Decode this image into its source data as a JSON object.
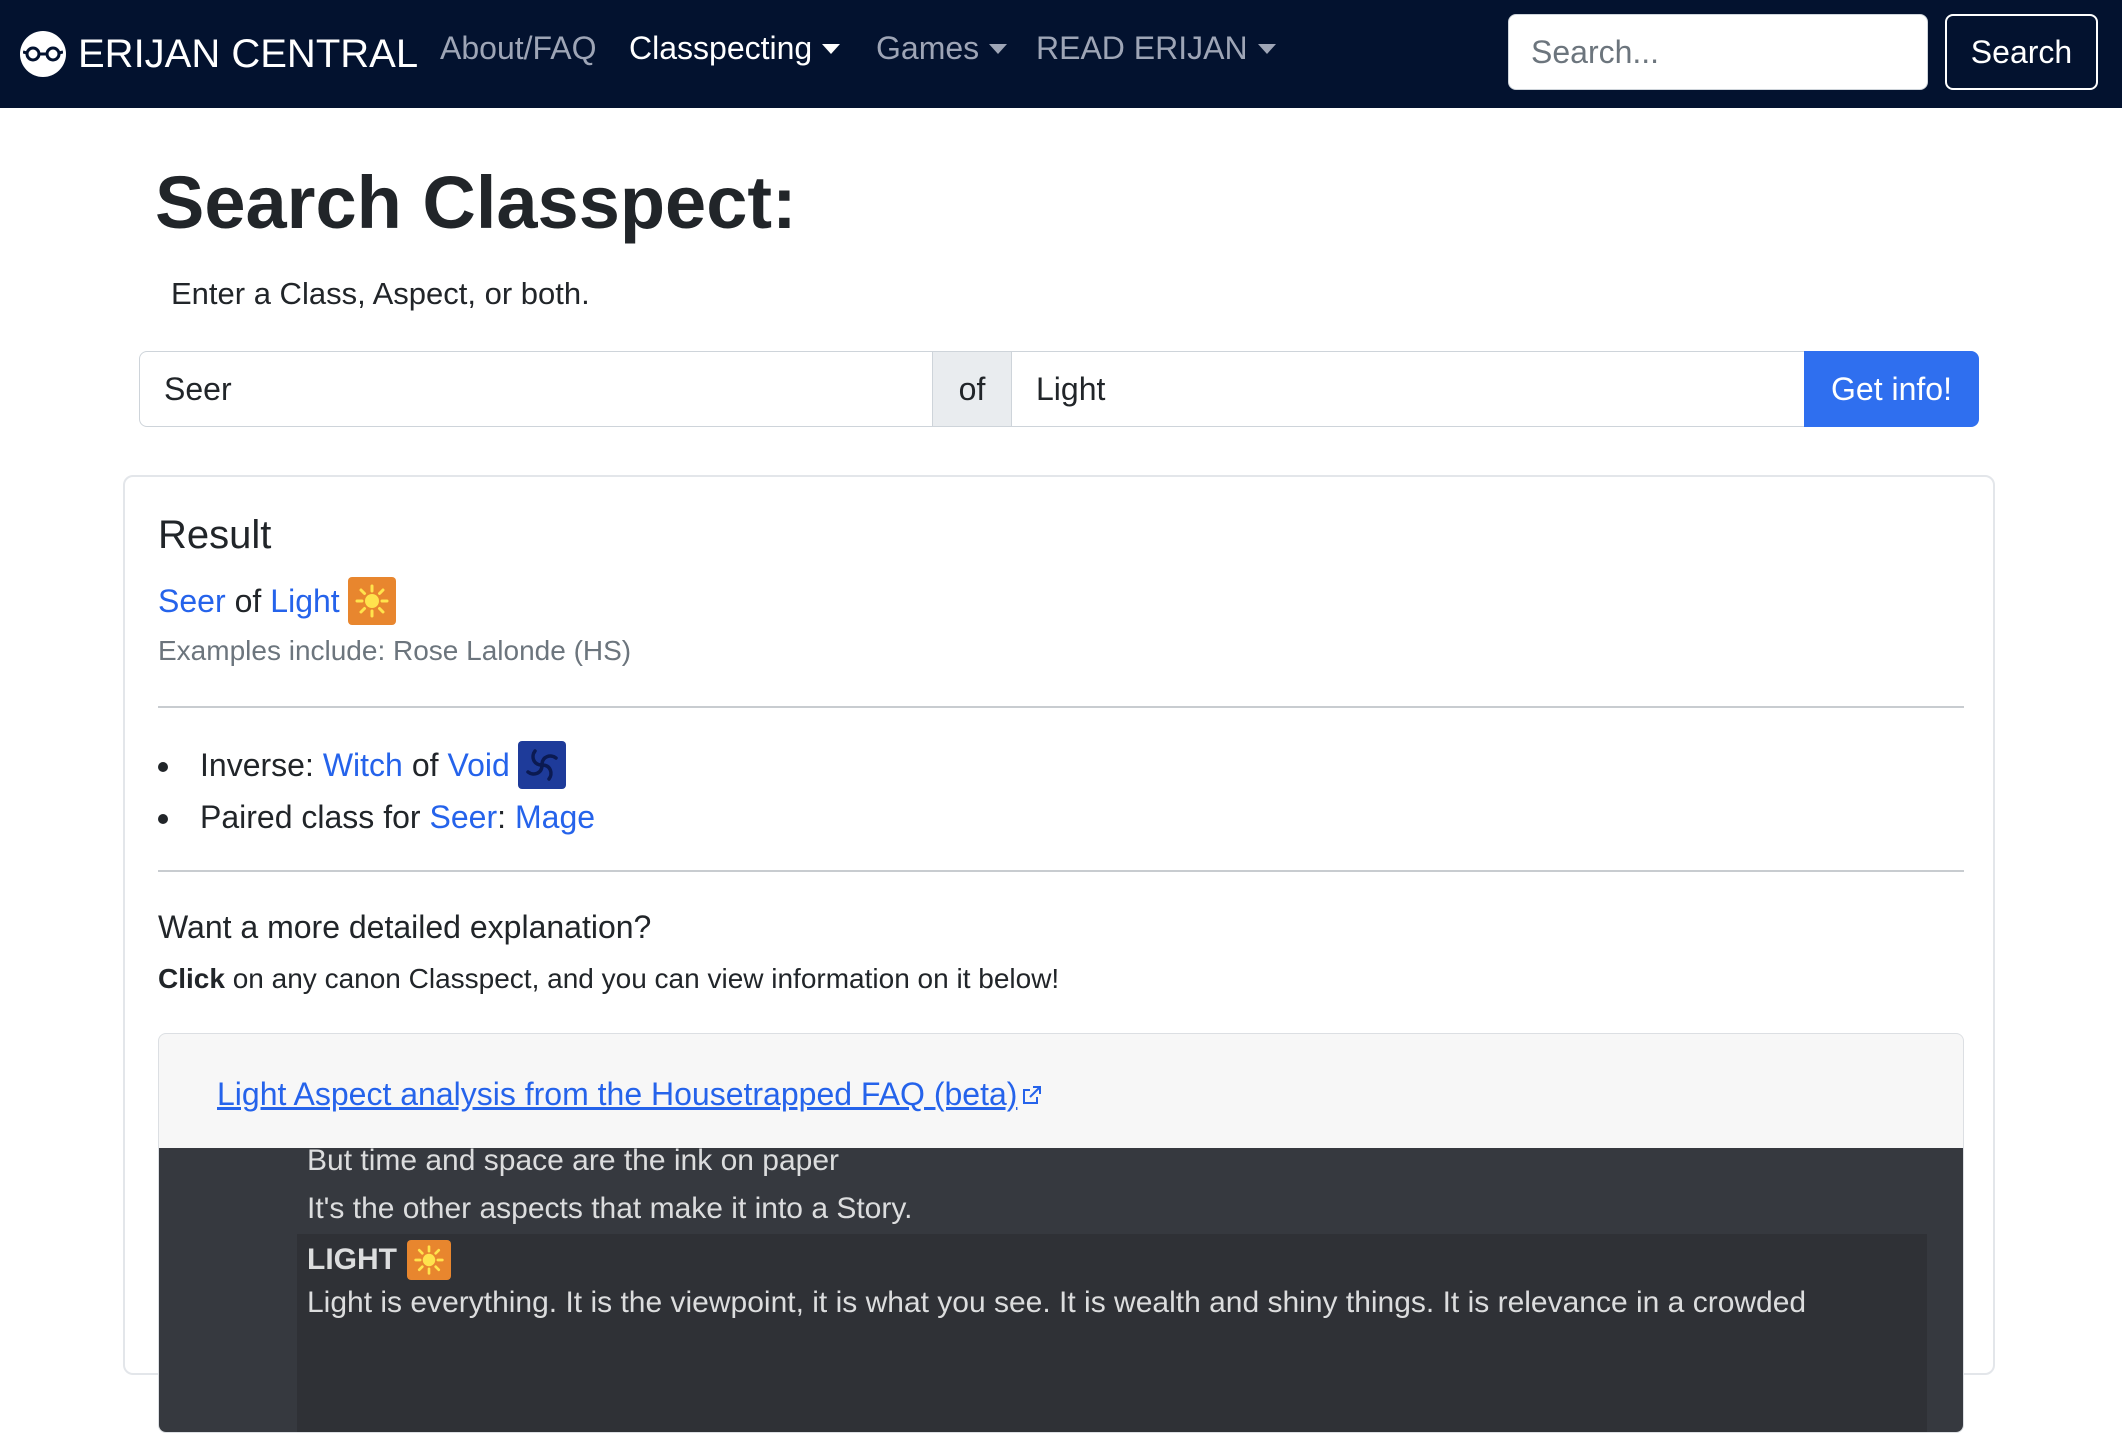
{
  "navbar": {
    "brand": "ERIJAN CENTRAL",
    "items": [
      {
        "label": "About/FAQ",
        "dropdown": false,
        "active": false
      },
      {
        "label": "Classpecting",
        "dropdown": true,
        "active": true
      },
      {
        "label": "Games",
        "dropdown": true,
        "active": false
      },
      {
        "label": "READ ERIJAN",
        "dropdown": true,
        "active": false
      }
    ],
    "search_placeholder": "Search...",
    "search_button": "Search"
  },
  "page": {
    "title": "Search Classpect:",
    "subtitle": "Enter a Class, Aspect, or both."
  },
  "search_form": {
    "class_value": "Seer",
    "of_label": "of",
    "aspect_value": "Light",
    "button": "Get info!"
  },
  "result": {
    "heading": "Result",
    "class": "Seer",
    "of": "of",
    "aspect": "Light",
    "aspect_icon": "sun-icon",
    "examples": "Examples include: Rose Lalonde (HS)",
    "inverse_label": "Inverse:",
    "inverse_class": "Witch",
    "inverse_of": "of",
    "inverse_aspect": "Void",
    "inverse_icon": "void-swirl-icon",
    "paired_label": "Paired class for",
    "paired_class": "Seer",
    "paired_sep": ":",
    "paired_value": "Mage"
  },
  "explanation": {
    "question": "Want a more detailed explanation?",
    "detail_bold": "Click",
    "detail_rest": " on any canon Classpect, and you can view information on it below!"
  },
  "analysis": {
    "link": "Light Aspect analysis from the Housetrapped FAQ (beta) ",
    "lines": [
      "But time and space are the ink on paper",
      "It's the other aspects that make it into a Story."
    ],
    "aspect_heading": "LIGHT",
    "aspect_text": "Light is everything. It is the viewpoint, it is what you see. It is wealth and shiny things. It is relevance in a crowded"
  },
  "colors": {
    "navbar_bg": "#03122f",
    "link": "#2563eb",
    "primary_button": "#2f6fef",
    "light_badge": "#e8862e",
    "void_badge": "#1e3b9a",
    "dark_panel": "#36393f"
  }
}
